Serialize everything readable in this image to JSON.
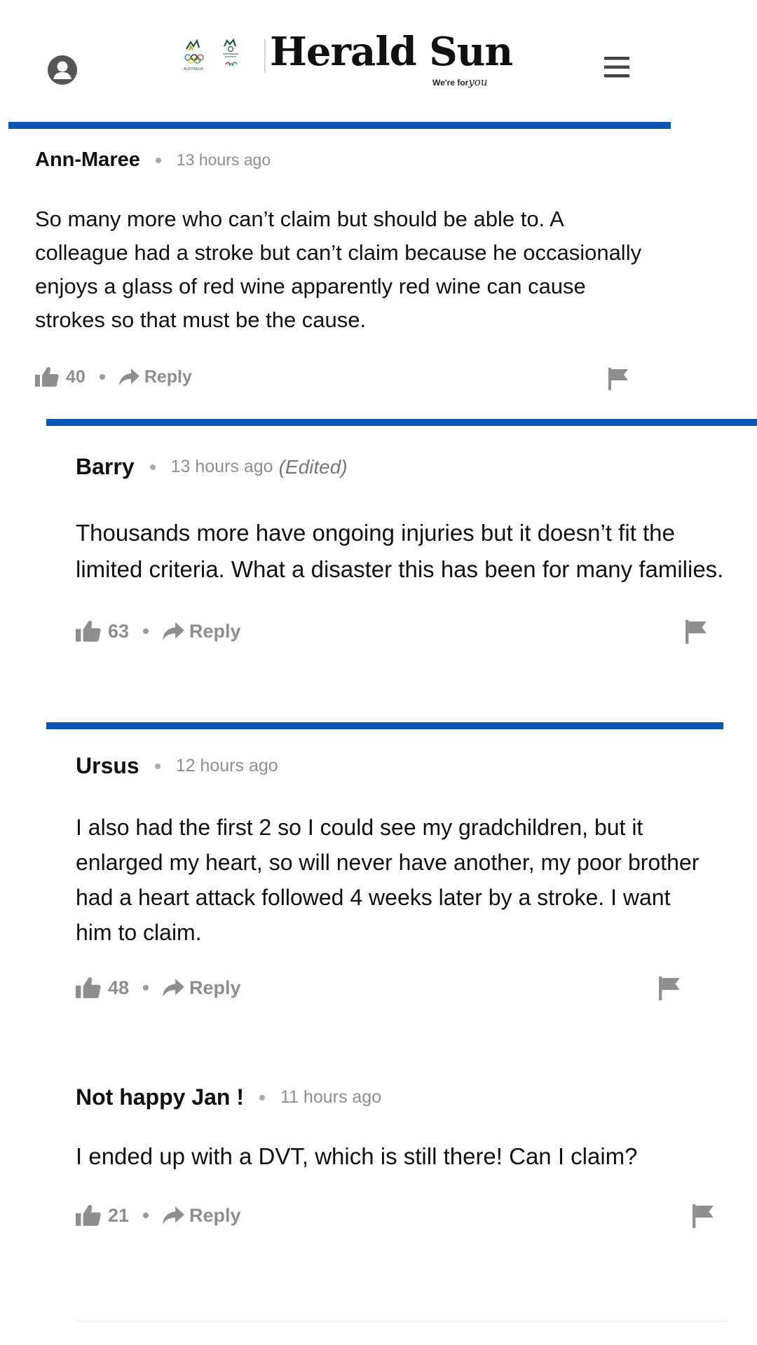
{
  "header": {
    "brand": "Herald Sun",
    "tagline": "We're for",
    "tagline_script": "you",
    "olympic_text": "AUSTRALIA"
  },
  "colors": {
    "accent_blue": "#0b56b3",
    "meta_grey": "#8e8e8e"
  },
  "comments": [
    {
      "author": "Ann-Maree",
      "time": "13 hours ago",
      "edited": "",
      "body": "So many more who can’t claim but should be able to. A colleague had a stroke but can’t claim because he occasionally enjoys a glass of red wine apparently red wine can cause strokes so that must be the cause.",
      "likes": "40",
      "reply_label": "Reply"
    },
    {
      "author": "Barry",
      "time": "13 hours ago",
      "edited": "(Edited)",
      "body": "Thousands more have ongoing injuries but it doesn’t fit the limited criteria. What a disaster this has been for many families.",
      "likes": "63",
      "reply_label": "Reply"
    },
    {
      "author": "Ursus",
      "time": "12 hours ago",
      "edited": "",
      "body": "I also had the first 2 so I could see my gradchildren, but it enlarged my heart, so will never have another, my poor brother had a heart attack followed 4 weeks later by a stroke. I want him to claim.",
      "likes": "48",
      "reply_label": "Reply"
    },
    {
      "author": "Not happy Jan !",
      "time": "11 hours ago",
      "edited": "",
      "body": "I ended up with a DVT, which is still there! Can I claim?",
      "likes": "21",
      "reply_label": "Reply"
    }
  ],
  "icons": {
    "user": "user-circle-icon",
    "menu": "hamburger-menu-icon",
    "like": "thumbs-up-icon",
    "reply": "reply-arrow-icon",
    "flag": "flag-icon"
  }
}
